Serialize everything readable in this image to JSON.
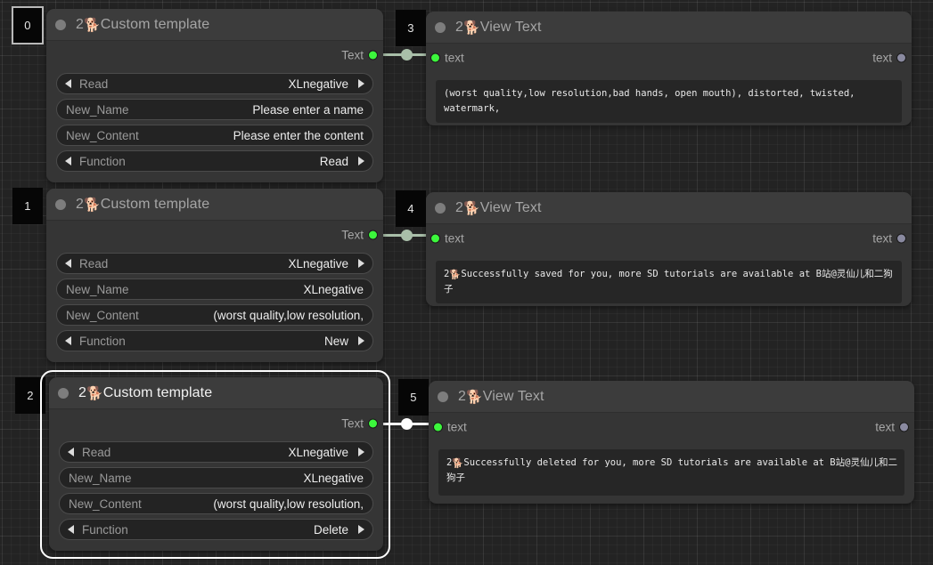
{
  "canvas": {
    "background_color": "#232323",
    "grid_minor_color": "#2b2b2b",
    "grid_major_color": "#333333"
  },
  "colors": {
    "node_body": "#353535",
    "node_header": "#3c3c3c",
    "widget_bg": "#232323",
    "port_connected": "#3cf73c",
    "port_idle": "#8a8aa0",
    "link": "#a9bfa9",
    "link_selected": "#ffffff",
    "emoji_accent": "#e2943f"
  },
  "emoji": "🐕",
  "nodes": [
    {
      "id": "node-0",
      "badge": "0",
      "badge_outlined": true,
      "title_prefix": "2",
      "title": "Custom template",
      "selected": false,
      "output_port_label": "Text",
      "widgets": [
        {
          "type": "combo",
          "name": "Read",
          "value": "XLnegative"
        },
        {
          "type": "text",
          "name": "New_Name",
          "value": "Please enter a name"
        },
        {
          "type": "text",
          "name": "New_Content",
          "value": "Please enter the content"
        },
        {
          "type": "combo",
          "name": "Function",
          "value": "Read"
        }
      ]
    },
    {
      "id": "node-1",
      "badge": "1",
      "badge_outlined": false,
      "title_prefix": "2",
      "title": "Custom template",
      "selected": false,
      "output_port_label": "Text",
      "widgets": [
        {
          "type": "combo",
          "name": "Read",
          "value": "XLnegative"
        },
        {
          "type": "text",
          "name": "New_Name",
          "value": "XLnegative"
        },
        {
          "type": "text",
          "name": "New_Content",
          "value": "(worst quality,low resolution,"
        },
        {
          "type": "combo",
          "name": "Function",
          "value": "New"
        }
      ]
    },
    {
      "id": "node-2",
      "badge": "2",
      "badge_outlined": false,
      "title_prefix": "2",
      "title": "Custom template",
      "selected": true,
      "output_port_label": "Text",
      "widgets": [
        {
          "type": "combo",
          "name": "Read",
          "value": "XLnegative"
        },
        {
          "type": "text",
          "name": "New_Name",
          "value": "XLnegative"
        },
        {
          "type": "text",
          "name": "New_Content",
          "value": "(worst quality,low resolution,"
        },
        {
          "type": "combo",
          "name": "Function",
          "value": "Delete"
        }
      ]
    },
    {
      "id": "node-3",
      "badge": "3",
      "badge_outlined": false,
      "title_prefix": "2",
      "title": "View Text",
      "selected": false,
      "input_port_label": "text",
      "output_port_label": "text",
      "display_text_prefix": "",
      "display_text": "(worst quality,low resolution,bad hands, open mouth), distorted, twisted, watermark,"
    },
    {
      "id": "node-4",
      "badge": "4",
      "badge_outlined": false,
      "title_prefix": "2",
      "title": "View Text",
      "selected": false,
      "input_port_label": "text",
      "output_port_label": "text",
      "display_text_prefix": "2",
      "display_text": "Successfully saved for you, more SD tutorials are available at B站@灵仙儿和二狗子"
    },
    {
      "id": "node-5",
      "badge": "5",
      "badge_outlined": false,
      "title_prefix": "2",
      "title": "View Text",
      "selected": false,
      "input_port_label": "text",
      "output_port_label": "text",
      "display_text_prefix": "2",
      "display_text": "Successfully deleted for you, more SD tutorials are available at B站@灵仙儿和二狗子"
    }
  ]
}
